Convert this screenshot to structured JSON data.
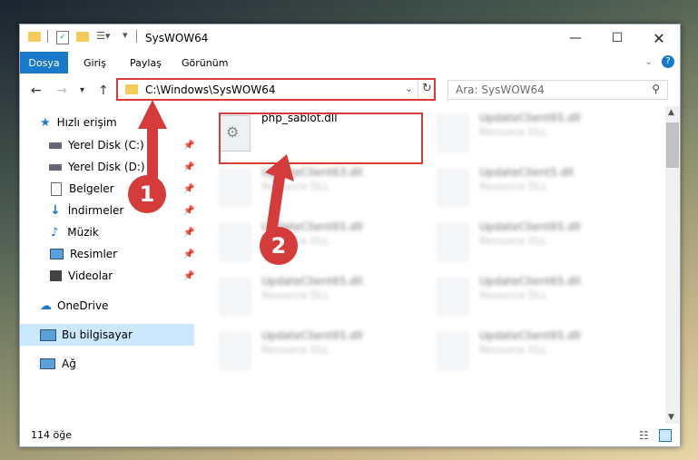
{
  "window": {
    "title": "SysWOW64"
  },
  "ribbon": {
    "tabs": [
      "Dosya",
      "Giriş",
      "Paylaş",
      "Görünüm"
    ]
  },
  "address": {
    "path": "C:\\Windows\\SysWOW64",
    "search_placeholder": "Ara: SysWOW64"
  },
  "sidebar": {
    "items": [
      {
        "label": "Hızlı erişim"
      },
      {
        "label": "Yerel Disk (C:)"
      },
      {
        "label": "Yerel Disk (D:)"
      },
      {
        "label": "Belgeler"
      },
      {
        "label": "İndirmeler"
      },
      {
        "label": "Müzik"
      },
      {
        "label": "Resimler"
      },
      {
        "label": "Videolar"
      },
      {
        "label": "OneDrive"
      },
      {
        "label": "Bu bilgisayar"
      },
      {
        "label": "Ağ"
      }
    ]
  },
  "files": [
    {
      "name": "php_sablot.dll",
      "type": ""
    },
    {
      "name": "UpdateClient65.dll",
      "type": "Resource DLL"
    },
    {
      "name": "UpdateClient63.dll",
      "type": "Resource DLL"
    },
    {
      "name": "UpdateClient5.dll",
      "type": "Resource DLL"
    },
    {
      "name": "UpdateClient65.dll",
      "type": "Resource DLL"
    },
    {
      "name": "UpdateClient65.dll",
      "type": "Resource DLL"
    },
    {
      "name": "UpdateClient65.dll",
      "type": "Resource DLL"
    },
    {
      "name": "UpdateClient65.dll",
      "type": "Resource DLL"
    },
    {
      "name": "UpdateClient65.dll",
      "type": "Resource DLL"
    },
    {
      "name": "UpdateClient65.dll",
      "type": "Resource DLL"
    }
  ],
  "status": {
    "count": "114 öğe"
  },
  "callouts": {
    "one": "1",
    "two": "2"
  },
  "colors": {
    "accent": "#1979ca",
    "highlight": "#d63b3b"
  }
}
